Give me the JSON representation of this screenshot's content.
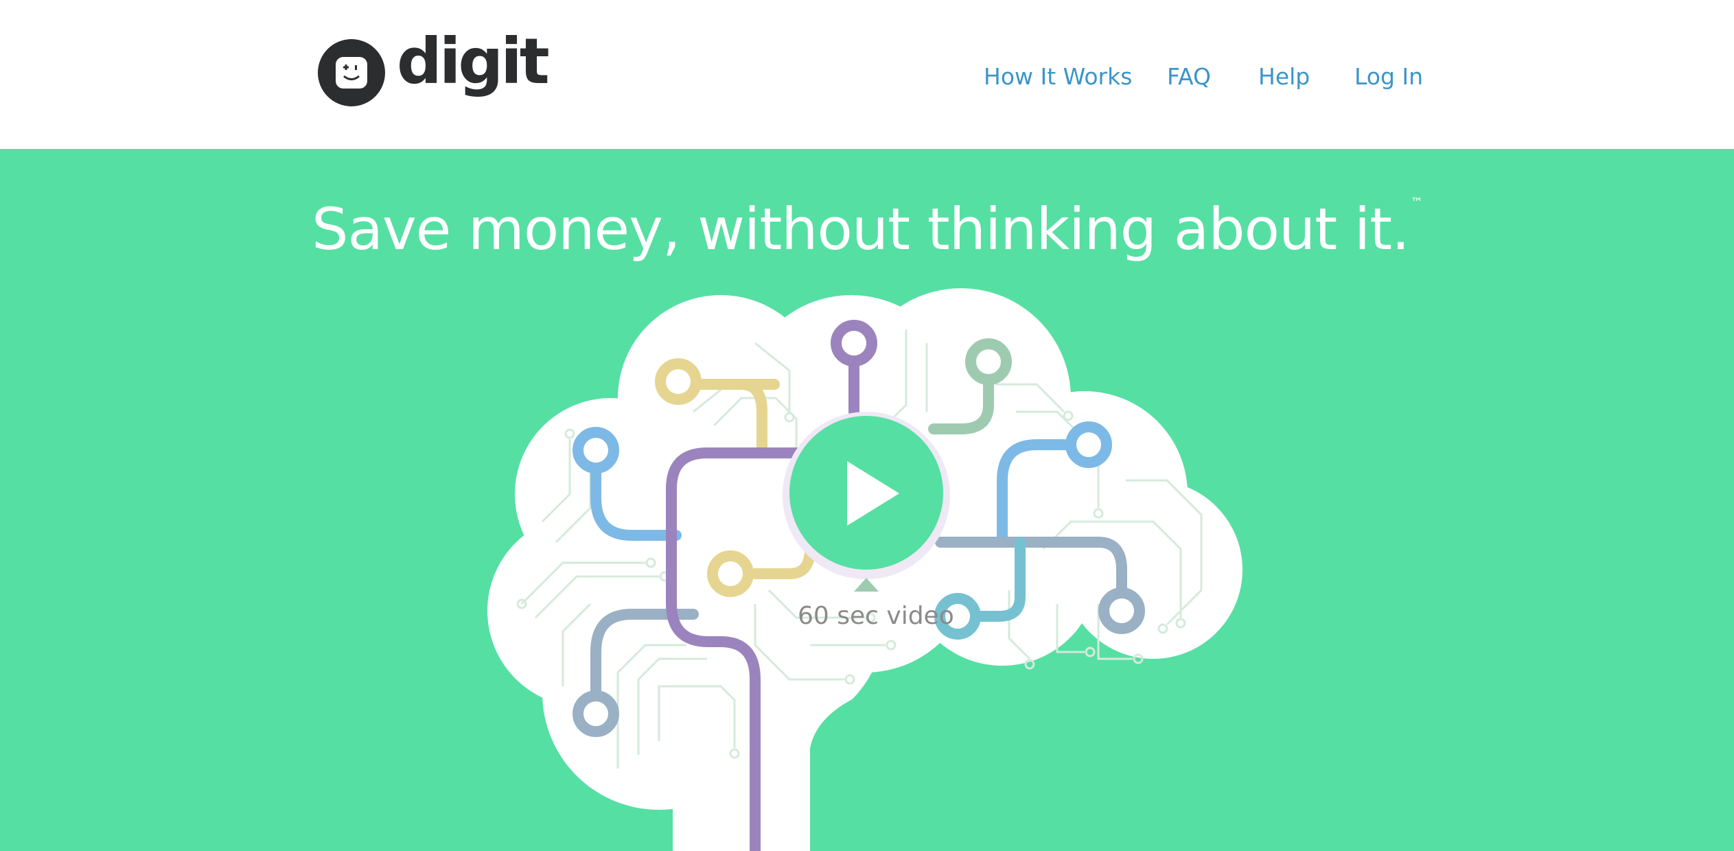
{
  "header": {
    "logo_text": "digit",
    "nav": [
      {
        "label": "How It Works"
      },
      {
        "label": "FAQ"
      },
      {
        "label": "Help"
      },
      {
        "label": "Log In"
      }
    ]
  },
  "hero": {
    "headline": "Save money, without thinking about it.",
    "trademark": "™",
    "video_label": "60 sec video"
  },
  "colors": {
    "brand_green": "#56dfa3",
    "link_blue": "#3a95c8",
    "logo_dark": "#2c2d2f",
    "branch_purple": "#9b84bd",
    "branch_yellow": "#e5d591",
    "branch_blue": "#7db9e6",
    "branch_sage": "#9ecbb0",
    "branch_slate": "#9ab0c4",
    "branch_teal": "#76c1d1"
  }
}
